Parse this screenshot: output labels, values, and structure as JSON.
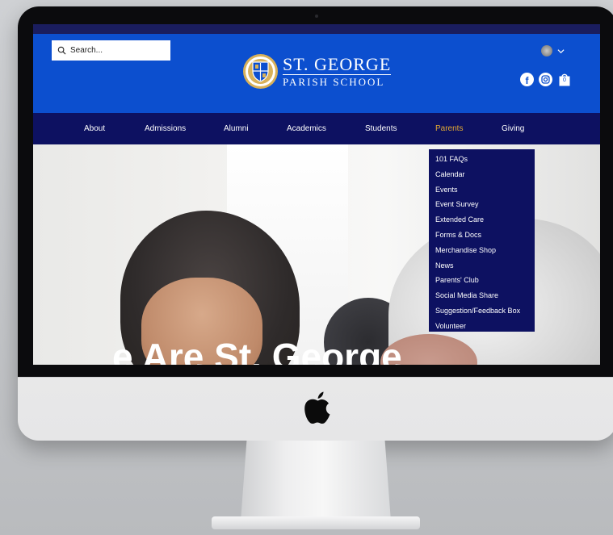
{
  "search": {
    "placeholder": "Search..."
  },
  "logo": {
    "line1": "ST. GEORGE",
    "line2": "PARISH SCHOOL"
  },
  "cart": {
    "count": "0"
  },
  "nav": {
    "items": [
      {
        "label": "About"
      },
      {
        "label": "Admissions"
      },
      {
        "label": "Alumni"
      },
      {
        "label": "Academics"
      },
      {
        "label": "Students"
      },
      {
        "label": "Parents"
      },
      {
        "label": "Giving"
      }
    ],
    "active": "Parents"
  },
  "parents_menu": {
    "items": [
      {
        "label": "101 FAQs"
      },
      {
        "label": "Calendar"
      },
      {
        "label": "Events"
      },
      {
        "label": "Event Survey"
      },
      {
        "label": "Extended Care"
      },
      {
        "label": "Forms & Docs"
      },
      {
        "label": "Merchandise Shop"
      },
      {
        "label": "News"
      },
      {
        "label": "Parents' Club"
      },
      {
        "label": "Social Media Share"
      },
      {
        "label": "Suggestion/Feedback Box"
      },
      {
        "label": "Volunteer"
      }
    ]
  },
  "hero": {
    "headline": "e Are St. George"
  },
  "colors": {
    "header_blue": "#0c4fcf",
    "nav_navy": "#0d1161",
    "active_gold": "#e2a933",
    "text_white": "#ffffff"
  },
  "icons": {
    "search": "search-icon",
    "language": "language-flag-icon",
    "chevron": "chevron-down-icon",
    "facebook": "facebook-icon",
    "instagram": "instagram-icon",
    "cart": "shopping-bag-icon",
    "brand": "apple-logo-icon"
  }
}
